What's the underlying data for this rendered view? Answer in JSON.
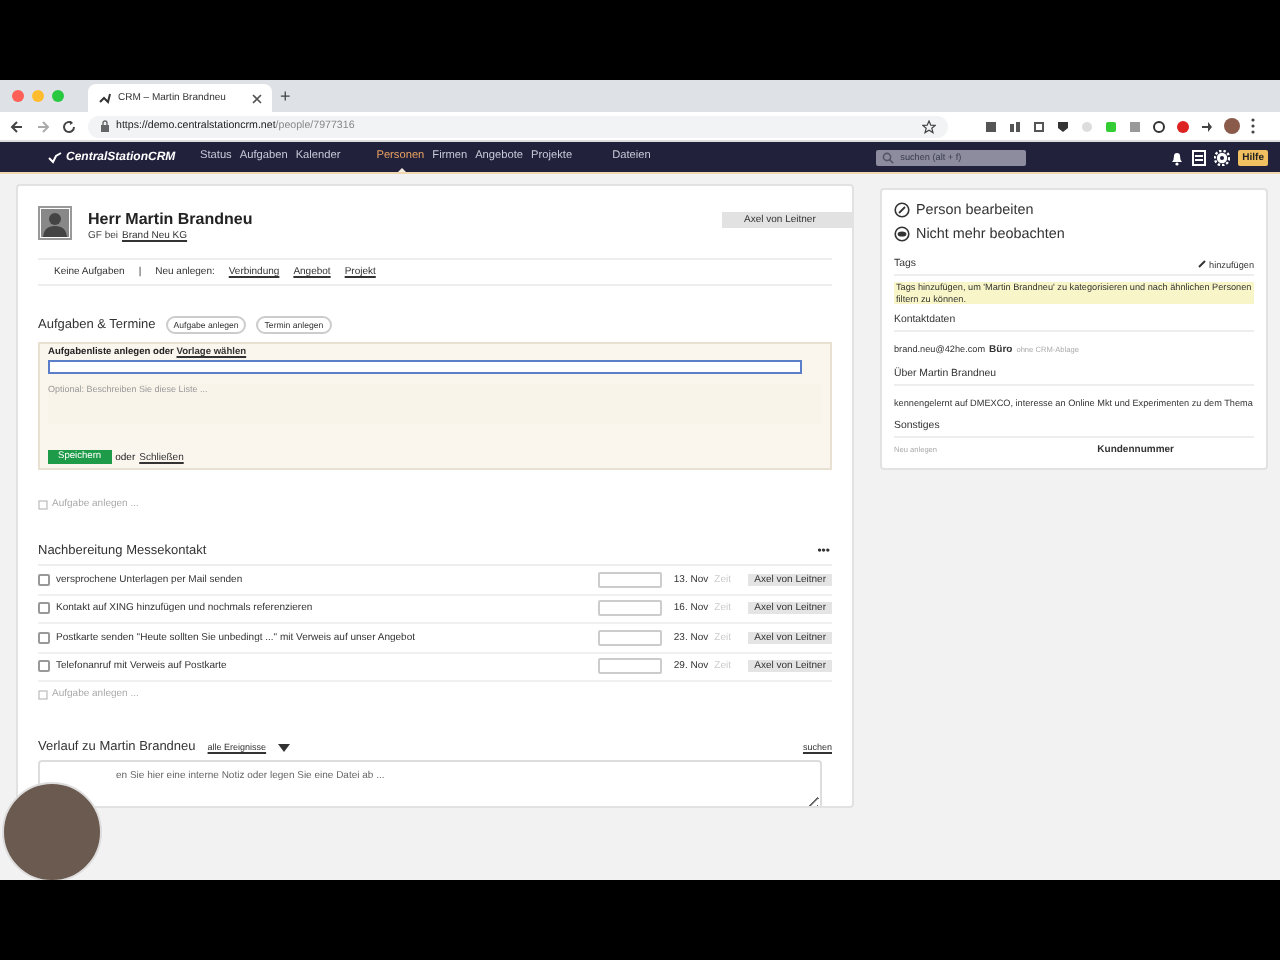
{
  "browser": {
    "tab_title": "CRM – Martin Brandneu",
    "new_tab": "+",
    "url_host": "https://demo.centralstationcrm.net",
    "url_path": "/people/7977316"
  },
  "nav": {
    "logo": "CentralStationCRM",
    "items": [
      {
        "label": "Status",
        "selected": false
      },
      {
        "label": "Aufgaben",
        "selected": false
      },
      {
        "label": "Kalender",
        "selected": false
      },
      {
        "label": "Personen",
        "selected": true
      },
      {
        "label": "Firmen",
        "selected": false
      },
      {
        "label": "Angebote",
        "selected": false
      },
      {
        "label": "Projekte",
        "selected": false
      },
      {
        "label": "Dateien",
        "selected": false
      }
    ],
    "search": {
      "placeholder": "suchen (alt + f)"
    },
    "help": "Hilfe"
  },
  "person": {
    "name": "Herr Martin Brandneu",
    "role": "GF bei",
    "company": "Brand Neu KG",
    "owner": "Axel von Leitner"
  },
  "actions": {
    "tasks": "Keine Aufgaben",
    "separator": "|",
    "new_label": "Neu anlegen:",
    "links": [
      "Verbindung",
      "Angebot",
      "Projekt"
    ]
  },
  "tasks_section": {
    "title": "Aufgaben & Termine",
    "buttons": [
      "Aufgabe anlegen",
      "Termin anlegen"
    ]
  },
  "list_form": {
    "label": "Aufgabenliste anlegen oder",
    "link": "Vorlage wählen",
    "description_placeholder": "Optional: Beschreiben Sie diese Liste ...",
    "save": "Speichern",
    "or": "oder",
    "close": "Schließen"
  },
  "add_task": "Aufgabe anlegen ...",
  "task_list": {
    "title": "Nachbereitung Messekontakt",
    "menu": "•••",
    "tasks": [
      {
        "text": "versprochene Unterlagen per Mail senden",
        "checked": false,
        "date": "13. Nov",
        "time": "Zeit",
        "assignee": "Axel von Leitner"
      },
      {
        "text": "Kontakt auf XING hinzufügen und nochmals referenzieren",
        "checked": false,
        "date": "16. Nov",
        "time": "Zeit",
        "assignee": "Axel von Leitner"
      },
      {
        "text": "Postkarte senden \"Heute sollten Sie unbedingt ...\" mit Verweis auf unser Angebot",
        "checked": false,
        "date": "23. Nov",
        "time": "Zeit",
        "assignee": "Axel von Leitner"
      },
      {
        "text": "Telefonanruf mit Verweis auf Postkarte",
        "checked": false,
        "date": "29. Nov",
        "time": "Zeit",
        "assignee": "Axel von Leitner"
      }
    ],
    "add_task": "Aufgabe anlegen ..."
  },
  "history": {
    "title": "Verlauf zu Martin Brandneu",
    "filter": "alle Ereignisse",
    "search": "suchen",
    "note_placeholder": "en Sie hier eine interne Notiz oder legen Sie eine Datei ab ..."
  },
  "sidebar": {
    "actions": [
      {
        "label": "Person bearbeiten",
        "kind": "edit"
      },
      {
        "label": "Nicht mehr beobachten",
        "kind": "watch"
      }
    ],
    "tags": {
      "title": "Tags",
      "add": "hinzufügen",
      "hint": "Tags hinzufügen, um 'Martin Brandneu' zu kategorisieren und nach ähnlichen Personen filtern zu können."
    },
    "contact": {
      "title": "Kontaktdaten",
      "email": "brand.neu@42he.com",
      "type": "Büro",
      "note": "ohne CRM-Ablage"
    },
    "about": {
      "title": "Über Martin Brandneu",
      "text": "kennengelernt auf DMEXCO, interesse an Online Mkt und Experimenten zu dem Thema"
    },
    "misc": {
      "title": "Sonstiges",
      "add": "Neu anlegen",
      "field": "Kundennummer"
    }
  }
}
